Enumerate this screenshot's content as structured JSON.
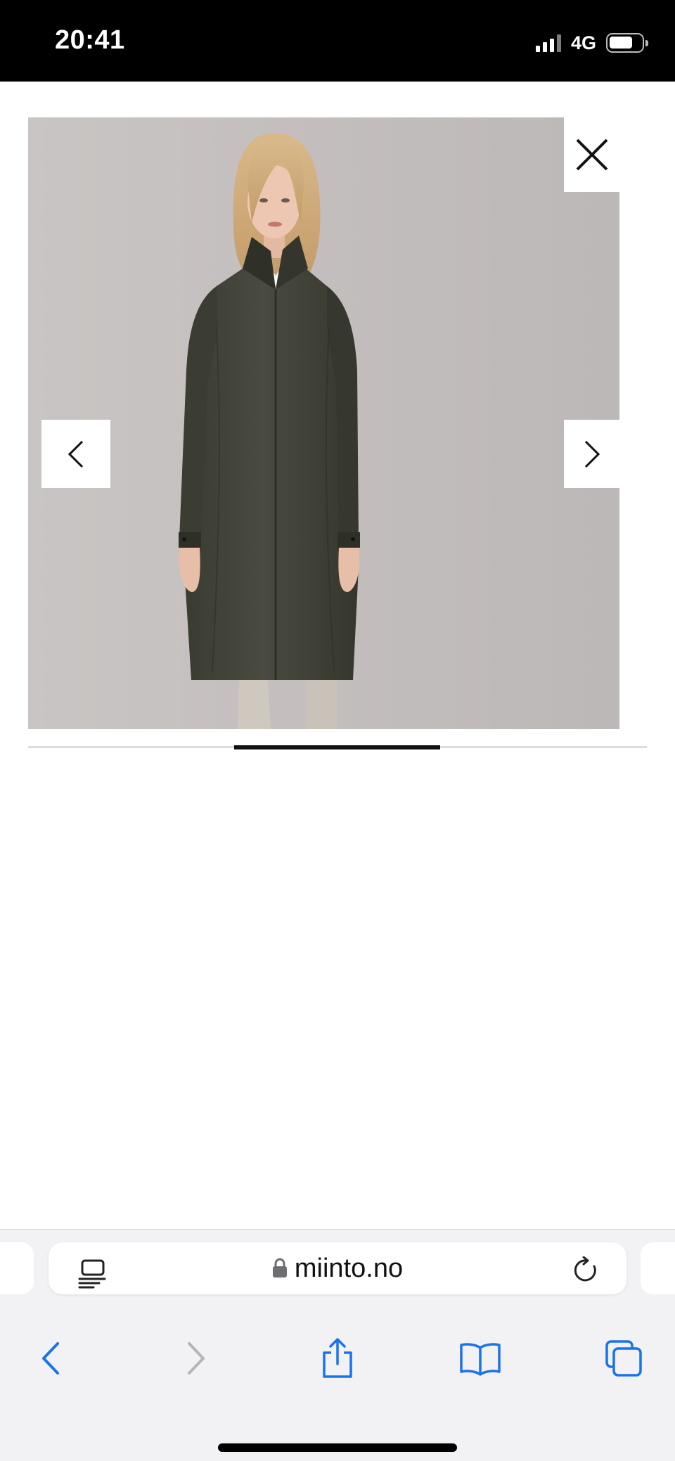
{
  "status_bar": {
    "time": "20:41",
    "network": "4G",
    "signal_bars_active": 3,
    "battery_level": 0.75
  },
  "gallery": {
    "image_description_icon": "product-photo",
    "current_slide_fraction_start": 0.3333,
    "current_slide_fraction_end": 0.6667,
    "close_icon": "close-icon",
    "prev_icon": "chevron-left-icon",
    "next_icon": "chevron-right-icon"
  },
  "browser": {
    "url": "miinto.no",
    "secure_icon": "lock-icon",
    "page_menu_icon": "page-menu-icon",
    "reload_icon": "reload-icon",
    "toolbar": {
      "back_icon": "chevron-left-icon",
      "forward_icon": "chevron-right-icon",
      "share_icon": "share-icon",
      "bookmarks_icon": "book-icon",
      "tabs_icon": "tabs-icon"
    },
    "colors": {
      "accent": "#1a73e8",
      "disabled": "#b5b5b9"
    }
  }
}
